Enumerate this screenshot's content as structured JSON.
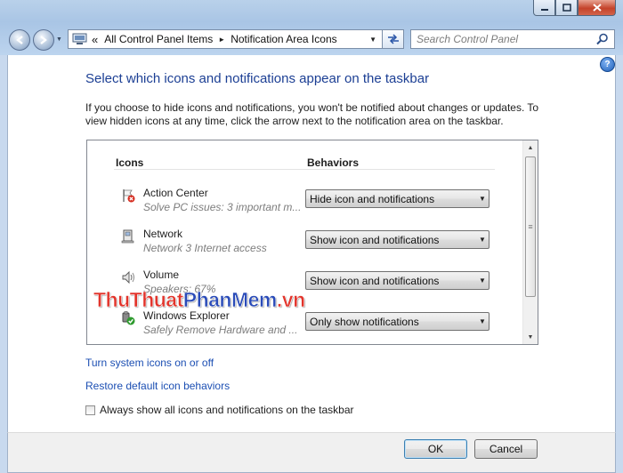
{
  "address_bar": {
    "crumbs": [
      "All Control Panel Items",
      "Notification Area Icons"
    ],
    "overflow": "«"
  },
  "search": {
    "placeholder": "Search Control Panel"
  },
  "page": {
    "title": "Select which icons and notifications appear on the taskbar",
    "description": "If you choose to hide icons and notifications, you won't be notified about changes or updates. To view hidden icons at any time, click the arrow next to the notification area on the taskbar."
  },
  "table": {
    "headers": {
      "icons": "Icons",
      "behaviors": "Behaviors"
    },
    "rows": [
      {
        "name": "Action Center",
        "detail": "Solve PC issues: 3 important m...",
        "behavior": "Hide icon and notifications",
        "icon": "action-center-flag-icon"
      },
      {
        "name": "Network",
        "detail": "Network  3 Internet access",
        "behavior": "Show icon and notifications",
        "icon": "network-computer-icon"
      },
      {
        "name": "Volume",
        "detail": "Speakers: 67%",
        "behavior": "Show icon and notifications",
        "icon": "speaker-volume-icon"
      },
      {
        "name": "Windows Explorer",
        "detail": "Safely Remove Hardware and ...",
        "behavior": "Only show notifications",
        "icon": "safely-remove-hardware-icon"
      }
    ]
  },
  "links": {
    "system_icons": "Turn system icons on or off",
    "restore": "Restore default icon behaviors"
  },
  "checkbox": {
    "label": "Always show all icons and notifications on the taskbar",
    "checked": false
  },
  "buttons": {
    "ok": "OK",
    "cancel": "Cancel"
  },
  "watermark": {
    "part1": "ThuThuat",
    "part2": "PhanMem",
    "part3": ".vn"
  },
  "colors": {
    "title_blue": "#1c3f94",
    "link_blue": "#1c4fb3",
    "window_frame": "#b9d1ea"
  }
}
